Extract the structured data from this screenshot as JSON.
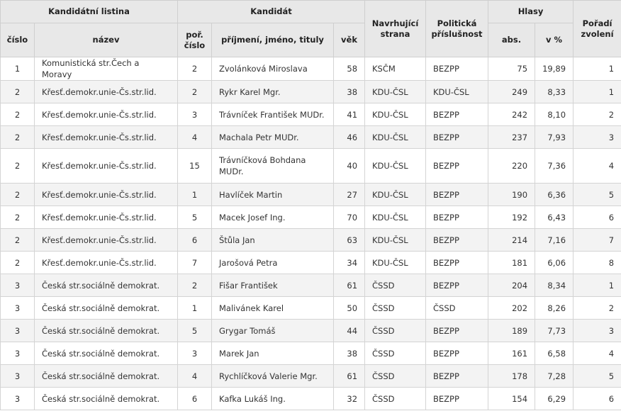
{
  "headers": {
    "group_list": "Kandidátní listina",
    "group_candidate": "Kandidát",
    "proposing_party": "Navrhující strana",
    "political_affiliation": "Politická příslušnost",
    "group_votes": "Hlasy",
    "election_order": "Pořadí zvolení",
    "list_number": "číslo",
    "list_name": "název",
    "candidate_number": "poř. číslo",
    "candidate_name": "příjmení, jméno, tituly",
    "age": "věk",
    "votes_abs": "abs.",
    "votes_pct": "v %"
  },
  "rows": [
    {
      "list_no": "1",
      "list_name": "Komunistická str.Čech a Moravy",
      "cand_no": "2",
      "name": "Zvolánková Miroslava",
      "age": "58",
      "party": "KSČM",
      "affil": "BEZPP",
      "abs": "75",
      "pct": "19,89",
      "order": "1"
    },
    {
      "list_no": "2",
      "list_name": "Křesť.demokr.unie-Čs.str.lid.",
      "cand_no": "2",
      "name": "Rykr Karel Mgr.",
      "age": "38",
      "party": "KDU-ČSL",
      "affil": "KDU-ČSL",
      "abs": "249",
      "pct": "8,33",
      "order": "1"
    },
    {
      "list_no": "2",
      "list_name": "Křesť.demokr.unie-Čs.str.lid.",
      "cand_no": "3",
      "name": "Trávníček František MUDr.",
      "age": "41",
      "party": "KDU-ČSL",
      "affil": "BEZPP",
      "abs": "242",
      "pct": "8,10",
      "order": "2"
    },
    {
      "list_no": "2",
      "list_name": "Křesť.demokr.unie-Čs.str.lid.",
      "cand_no": "4",
      "name": "Machala Petr MUDr.",
      "age": "46",
      "party": "KDU-ČSL",
      "affil": "BEZPP",
      "abs": "237",
      "pct": "7,93",
      "order": "3"
    },
    {
      "list_no": "2",
      "list_name": "Křesť.demokr.unie-Čs.str.lid.",
      "cand_no": "15",
      "name": "Trávníčková Bohdana MUDr.",
      "age": "40",
      "party": "KDU-ČSL",
      "affil": "BEZPP",
      "abs": "220",
      "pct": "7,36",
      "order": "4"
    },
    {
      "list_no": "2",
      "list_name": "Křesť.demokr.unie-Čs.str.lid.",
      "cand_no": "1",
      "name": "Havlíček Martin",
      "age": "27",
      "party": "KDU-ČSL",
      "affil": "BEZPP",
      "abs": "190",
      "pct": "6,36",
      "order": "5"
    },
    {
      "list_no": "2",
      "list_name": "Křesť.demokr.unie-Čs.str.lid.",
      "cand_no": "5",
      "name": "Macek Josef Ing.",
      "age": "70",
      "party": "KDU-ČSL",
      "affil": "BEZPP",
      "abs": "192",
      "pct": "6,43",
      "order": "6"
    },
    {
      "list_no": "2",
      "list_name": "Křesť.demokr.unie-Čs.str.lid.",
      "cand_no": "6",
      "name": "Štůla Jan",
      "age": "63",
      "party": "KDU-ČSL",
      "affil": "BEZPP",
      "abs": "214",
      "pct": "7,16",
      "order": "7"
    },
    {
      "list_no": "2",
      "list_name": "Křesť.demokr.unie-Čs.str.lid.",
      "cand_no": "7",
      "name": "Jarošová Petra",
      "age": "34",
      "party": "KDU-ČSL",
      "affil": "BEZPP",
      "abs": "181",
      "pct": "6,06",
      "order": "8"
    },
    {
      "list_no": "3",
      "list_name": "Česká str.sociálně demokrat.",
      "cand_no": "2",
      "name": "Fišar František",
      "age": "61",
      "party": "ČSSD",
      "affil": "BEZPP",
      "abs": "204",
      "pct": "8,34",
      "order": "1"
    },
    {
      "list_no": "3",
      "list_name": "Česká str.sociálně demokrat.",
      "cand_no": "1",
      "name": "Malivánek Karel",
      "age": "50",
      "party": "ČSSD",
      "affil": "ČSSD",
      "abs": "202",
      "pct": "8,26",
      "order": "2"
    },
    {
      "list_no": "3",
      "list_name": "Česká str.sociálně demokrat.",
      "cand_no": "5",
      "name": "Grygar Tomáš",
      "age": "44",
      "party": "ČSSD",
      "affil": "BEZPP",
      "abs": "189",
      "pct": "7,73",
      "order": "3"
    },
    {
      "list_no": "3",
      "list_name": "Česká str.sociálně demokrat.",
      "cand_no": "3",
      "name": "Marek Jan",
      "age": "38",
      "party": "ČSSD",
      "affil": "BEZPP",
      "abs": "161",
      "pct": "6,58",
      "order": "4"
    },
    {
      "list_no": "3",
      "list_name": "Česká str.sociálně demokrat.",
      "cand_no": "4",
      "name": "Rychlíčková Valerie Mgr.",
      "age": "61",
      "party": "ČSSD",
      "affil": "BEZPP",
      "abs": "178",
      "pct": "7,28",
      "order": "5"
    },
    {
      "list_no": "3",
      "list_name": "Česká str.sociálně demokrat.",
      "cand_no": "6",
      "name": "Kafka Lukáš Ing.",
      "age": "32",
      "party": "ČSSD",
      "affil": "BEZPP",
      "abs": "154",
      "pct": "6,29",
      "order": "6"
    }
  ]
}
